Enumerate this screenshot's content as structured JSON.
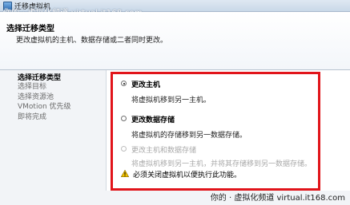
{
  "window": {
    "title": "迁移虚拟机",
    "watermark_top": "你的 · 虚拟化频道  virtual.it168.com"
  },
  "header": {
    "title": "选择迁移类型",
    "subtitle": "更改虚拟机的主机、数据存储或二者同时更改。"
  },
  "nav": {
    "items": [
      {
        "label": "选择迁移类型",
        "active": true
      },
      {
        "label": "选择目标",
        "active": false
      },
      {
        "label": "选择资源池",
        "active": false
      },
      {
        "label": "VMotion 优先级",
        "active": false
      },
      {
        "label": "即将完成",
        "active": false
      }
    ]
  },
  "options": [
    {
      "label": "更改主机",
      "description": "将虚拟机移到另一主机。",
      "selected": true,
      "enabled": true
    },
    {
      "label": "更改数据存储",
      "description": "将虚拟机的存储移到另一数据存储。",
      "selected": false,
      "enabled": true
    },
    {
      "label": "更改主机和数据存储",
      "description": "将虚拟机移到另一主机，并将其存储移到另一数据存储。",
      "selected": false,
      "enabled": false
    }
  ],
  "warning": {
    "text": "必须关闭虚拟机以便执行此功能。"
  },
  "footer": {
    "watermark": "你的 · 虚拟化频道  virtual.it168.com"
  },
  "colors": {
    "highlight_border": "#e1141a",
    "warning_icon": "#f2c200"
  }
}
